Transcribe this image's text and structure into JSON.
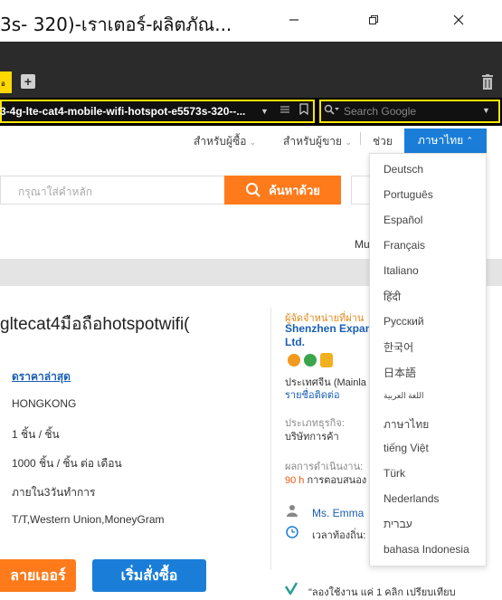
{
  "window": {
    "title": "3s- 320)-เราเตอร์-ผลิตภัณ..."
  },
  "tabs": {
    "active_label": "อ"
  },
  "navbar": {
    "url": "3-4g-lte-cat4-mobile-wifi-hotspot-e5573s-320--...",
    "search_placeholder": "Search Google"
  },
  "toplinks": {
    "link1": "สำหรับผู้ซื้อ",
    "link2": "สำหรับผู้ขาย",
    "help": "ช่วย",
    "language_button": "ภาษาไทย"
  },
  "search": {
    "placeholder": "กรุณาใส่คำหลัก",
    "button_label": "ค้นหาด้วย"
  },
  "page": {
    "right_partial": "Mu"
  },
  "product": {
    "title": "gltecat4มือถือhotspotwifi(",
    "price_link": "ดราคาล่าสุด",
    "origin": "HONGKONG",
    "min_order": "1 ชิ้น / ชิ้น",
    "supply": "1000 ชิ้น / ชิ้น ต่อ เดือน",
    "delivery": "ภายใน3วันทำการ",
    "payment": "T/T,Western Union,MoneyGram",
    "btn_contact": "ลายเออร์",
    "btn_order": "เริ่มสั่งซื้อ"
  },
  "supplier": {
    "label": "ผู้จัดจำหน่ายที่ผ่าน",
    "name_line1": "Shenzhen Expand",
    "name_line2": "Ltd.",
    "country": "ประเทศจีน (Mainla",
    "contact_list": "รายชื่อติดต่อ",
    "business_type_label": "ประเภทธุรกิจ:",
    "business_type": "บริษัทการค้า",
    "performance_label": "ผลการดำเนินงาน:",
    "response_rate": "90 h",
    "response_text": " การตอบสนอง",
    "contact_name": "Ms. Emma",
    "local_time": "เวลาท้องถิ่น:",
    "promo": "\"ลองใช้งาน แค่ 1 คลิก เปรียบเทียบ"
  },
  "languages": [
    "Deutsch",
    "Português",
    "Español",
    "Français",
    "Italiano",
    "हिंदी",
    "Русский",
    "한국어",
    "日本語",
    "اللغة العربية",
    "ภาษาไทย",
    "tiếng Việt",
    "Türk",
    "Nederlands",
    "עברית",
    "bahasa Indonesia"
  ],
  "colors": {
    "accent_blue": "#1a7ed8",
    "accent_orange": "#ff7a1a",
    "highlight_yellow": "#ffe600"
  }
}
